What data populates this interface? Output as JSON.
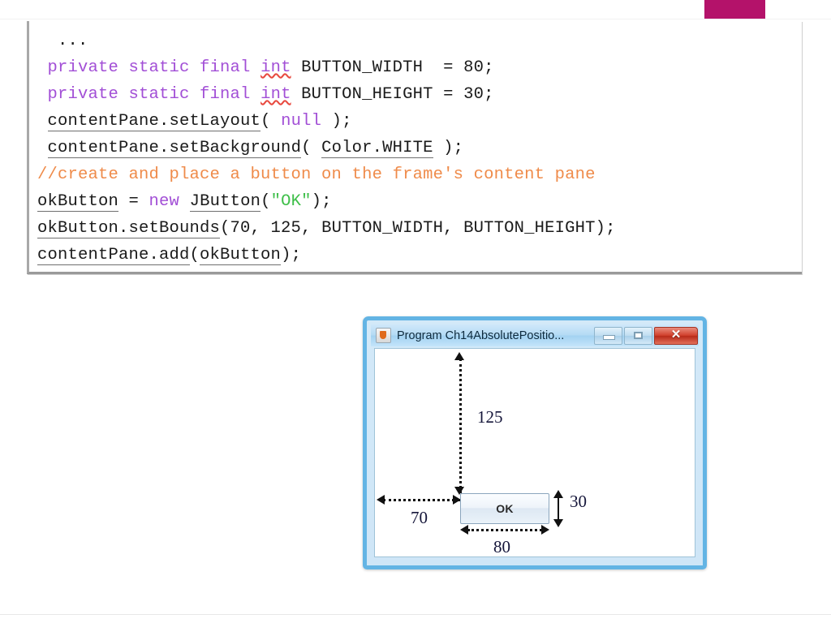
{
  "slide": {
    "accent_color": "#b4126a"
  },
  "code": {
    "language": "java",
    "colors": {
      "keyword": "#a24fd6",
      "comment": "#ef8b4a",
      "string": "#3fbf4a",
      "plain": "#1a1a1a",
      "spellcheck_underline": "#e8493f"
    },
    "lines": [
      {
        "tokens": [
          {
            "t": "  ...",
            "c": "plain"
          }
        ]
      },
      {
        "tokens": [
          {
            "t": " ",
            "c": "plain"
          },
          {
            "t": "private static final ",
            "c": "kw"
          },
          {
            "t": "int",
            "c": "kw-sq"
          },
          {
            "t": " BUTTON_WIDTH  = 80;",
            "c": "plain"
          }
        ]
      },
      {
        "tokens": [
          {
            "t": " ",
            "c": "plain"
          },
          {
            "t": "private static final ",
            "c": "kw"
          },
          {
            "t": "int",
            "c": "kw-sq"
          },
          {
            "t": " BUTTON_HEIGHT = 30;",
            "c": "plain"
          }
        ]
      },
      {
        "tokens": [
          {
            "t": " ",
            "c": "plain"
          },
          {
            "t": "contentPane.setLayout",
            "c": "plain-sq"
          },
          {
            "t": "( ",
            "c": "plain"
          },
          {
            "t": "null",
            "c": "kw"
          },
          {
            "t": " );",
            "c": "plain"
          }
        ]
      },
      {
        "tokens": [
          {
            "t": " ",
            "c": "plain"
          },
          {
            "t": "contentPane.setBackground",
            "c": "plain-sq"
          },
          {
            "t": "( ",
            "c": "plain"
          },
          {
            "t": "Color.WHITE",
            "c": "plain-sq"
          },
          {
            "t": " );",
            "c": "plain"
          }
        ]
      },
      {
        "tokens": [
          {
            "t": "//create and place a button on the frame's content pane",
            "c": "cmt"
          }
        ]
      },
      {
        "tokens": [
          {
            "t": "okButton",
            "c": "plain-sq"
          },
          {
            "t": " = ",
            "c": "plain"
          },
          {
            "t": "new",
            "c": "kw"
          },
          {
            "t": " ",
            "c": "plain"
          },
          {
            "t": "JButton",
            "c": "plain-sq"
          },
          {
            "t": "(",
            "c": "plain"
          },
          {
            "t": "\"OK\"",
            "c": "str"
          },
          {
            "t": ");",
            "c": "plain"
          }
        ]
      },
      {
        "tokens": [
          {
            "t": "okButton.setBounds",
            "c": "plain-sq"
          },
          {
            "t": "(70, 125, BUTTON_WIDTH, BUTTON_HEIGHT);",
            "c": "plain"
          }
        ]
      },
      {
        "tokens": [
          {
            "t": "contentPane.add",
            "c": "plain-sq"
          },
          {
            "t": "(",
            "c": "plain"
          },
          {
            "t": "okButton",
            "c": "plain-sq"
          },
          {
            "t": ");",
            "c": "plain"
          }
        ]
      }
    ]
  },
  "window": {
    "title": "Program Ch14AbsolutePositio...",
    "app_icon": "java-coffee-cup-icon",
    "controls": {
      "minimize": "minimize-icon",
      "maximize": "maximize-icon",
      "close": "✕"
    }
  },
  "diagram": {
    "button": {
      "label": "OK"
    },
    "dimensions": {
      "top_offset": "125",
      "left_offset": "70",
      "width": "80",
      "height": "30"
    }
  }
}
